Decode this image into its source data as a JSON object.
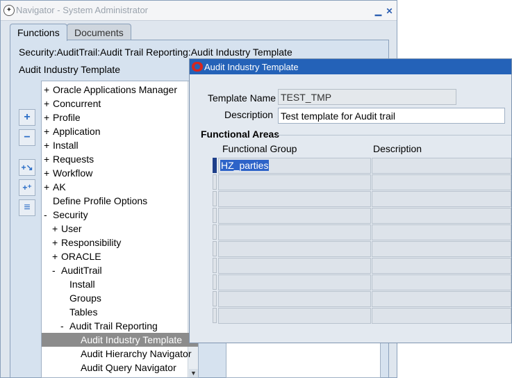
{
  "navigator": {
    "title": "Navigator - System Administrator",
    "title_buttons": [
      "minimize",
      "close"
    ],
    "tabs": [
      {
        "label": "Functions",
        "active": true
      },
      {
        "label": "Documents",
        "active": false
      }
    ],
    "breadcrumb": "Security:AuditTrail:Audit Trail Reporting:Audit Industry Template",
    "page_title": "Audit Industry Template",
    "side_buttons": [
      "expand-icon",
      "collapse-icon",
      "expand-branch-icon",
      "expand-all-icon",
      "collapse-all-icon"
    ],
    "tree": [
      {
        "prefix": "+",
        "label": "Oracle Applications Manager",
        "level": 0
      },
      {
        "prefix": "+",
        "label": "Concurrent",
        "level": 0
      },
      {
        "prefix": "+",
        "label": "Profile",
        "level": 0
      },
      {
        "prefix": "+",
        "label": "Application",
        "level": 0
      },
      {
        "prefix": "+",
        "label": "Install",
        "level": 0
      },
      {
        "prefix": "+",
        "label": "Requests",
        "level": 0
      },
      {
        "prefix": "+",
        "label": "Workflow",
        "level": 0
      },
      {
        "prefix": "+",
        "label": "AK",
        "level": 0
      },
      {
        "prefix": "",
        "label": "Define Profile Options",
        "level": 0
      },
      {
        "prefix": "-",
        "label": "Security",
        "level": 0
      },
      {
        "prefix": "+",
        "label": "User",
        "level": 1
      },
      {
        "prefix": "+",
        "label": "Responsibility",
        "level": 1
      },
      {
        "prefix": "+",
        "label": "ORACLE",
        "level": 1
      },
      {
        "prefix": "-",
        "label": "AuditTrail",
        "level": 1
      },
      {
        "prefix": "",
        "label": "Install",
        "level": 2
      },
      {
        "prefix": "",
        "label": "Groups",
        "level": 2
      },
      {
        "prefix": "",
        "label": "Tables",
        "level": 2
      },
      {
        "prefix": "-",
        "label": "Audit Trail Reporting",
        "level": 2
      },
      {
        "prefix": "",
        "label": "Audit Industry Template",
        "level": 3,
        "selected": true
      },
      {
        "prefix": "",
        "label": "Audit Hierarchy Navigator",
        "level": 3
      },
      {
        "prefix": "",
        "label": "Audit Query Navigator",
        "level": 3
      }
    ]
  },
  "dialog": {
    "title": "Audit Industry Template",
    "template_name_label": "Template Name",
    "template_name_value": "TEST_TMP",
    "description_label": "Description",
    "description_value": "Test template for Audit trail",
    "section_title": "Functional Areas",
    "columns": [
      "Functional Group",
      "Description"
    ],
    "rows": [
      {
        "group": "HZ_parties",
        "description": "",
        "current": true
      },
      {
        "group": "",
        "description": ""
      },
      {
        "group": "",
        "description": ""
      },
      {
        "group": "",
        "description": ""
      },
      {
        "group": "",
        "description": ""
      },
      {
        "group": "",
        "description": ""
      },
      {
        "group": "",
        "description": ""
      },
      {
        "group": "",
        "description": ""
      },
      {
        "group": "",
        "description": ""
      },
      {
        "group": "",
        "description": ""
      }
    ]
  }
}
